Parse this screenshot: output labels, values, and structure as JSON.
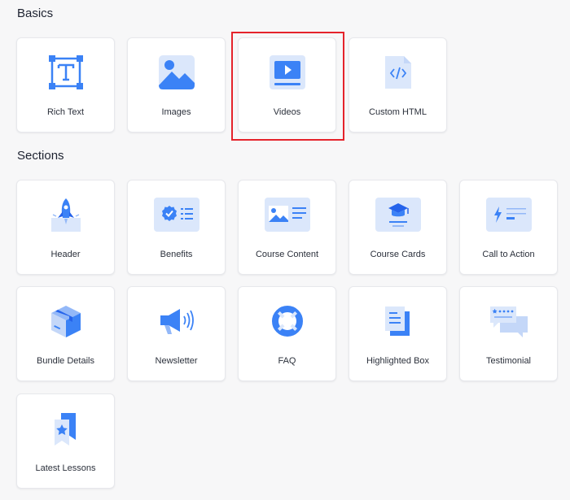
{
  "sections": {
    "basics": {
      "title": "Basics",
      "items": [
        {
          "label": "Rich Text",
          "icon": "text-box-icon"
        },
        {
          "label": "Images",
          "icon": "image-icon"
        },
        {
          "label": "Videos",
          "icon": "video-icon"
        },
        {
          "label": "Custom HTML",
          "icon": "code-file-icon"
        }
      ]
    },
    "sections": {
      "title": "Sections",
      "items": [
        {
          "label": "Header",
          "icon": "rocket-icon"
        },
        {
          "label": "Benefits",
          "icon": "badge-list-icon"
        },
        {
          "label": "Course Content",
          "icon": "image-text-icon"
        },
        {
          "label": "Course Cards",
          "icon": "graduation-cap-icon"
        },
        {
          "label": "Call to Action",
          "icon": "bolt-lines-icon"
        },
        {
          "label": "Bundle Details",
          "icon": "box-icon"
        },
        {
          "label": "Newsletter",
          "icon": "megaphone-icon"
        },
        {
          "label": "FAQ",
          "icon": "lifebuoy-icon"
        },
        {
          "label": "Highlighted Box",
          "icon": "stacked-document-icon"
        },
        {
          "label": "Testimonial",
          "icon": "chat-bubbles-icon"
        },
        {
          "label": "Latest Lessons",
          "icon": "bookmark-star-icon"
        }
      ]
    }
  },
  "highlighted_item": "Videos",
  "colors": {
    "accent": "#3b82f6",
    "accent_light": "#dbe7fb",
    "highlight_border": "#e5232b",
    "page_background": "#f7f7f8",
    "card_background": "#ffffff"
  }
}
